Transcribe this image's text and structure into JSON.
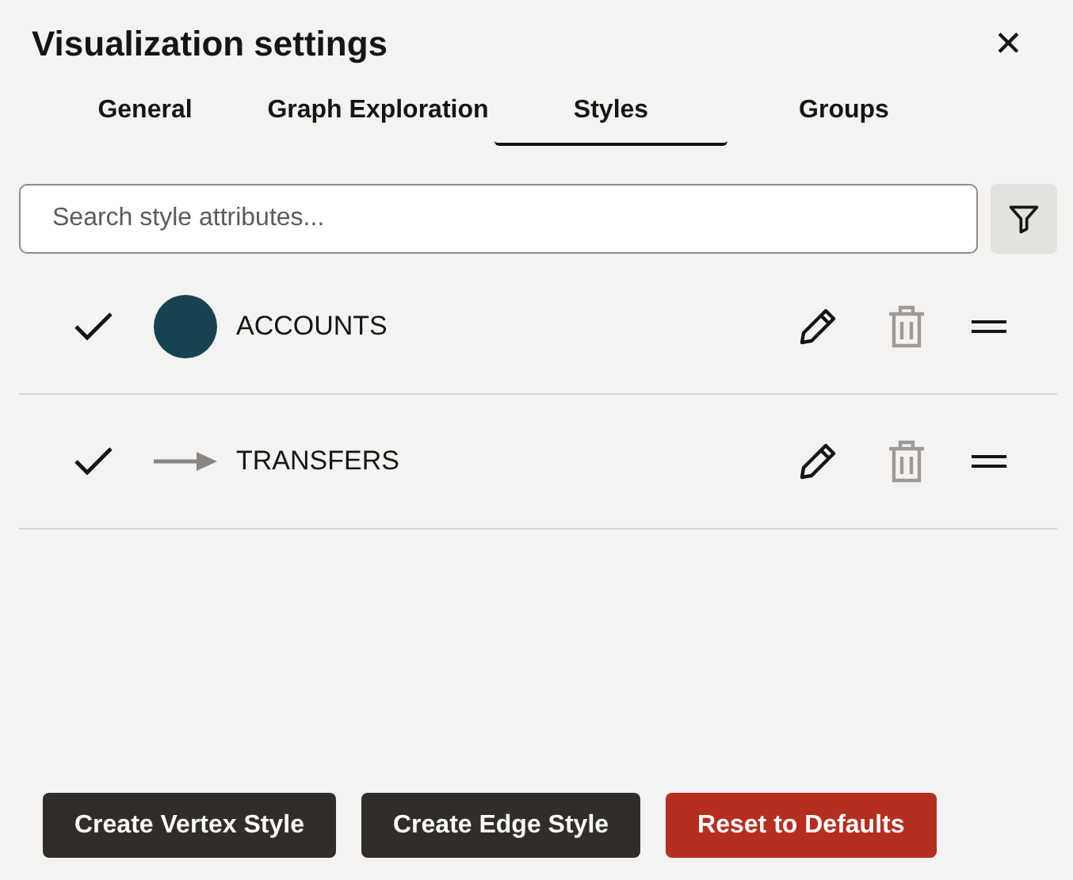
{
  "dialog": {
    "title": "Visualization settings",
    "close": "✕"
  },
  "tabs": [
    {
      "label": "General",
      "selected": false
    },
    {
      "label": "Graph Exploration",
      "selected": false
    },
    {
      "label": "Styles",
      "selected": true
    },
    {
      "label": "Groups",
      "selected": false
    }
  ],
  "search": {
    "placeholder": "Search style attributes..."
  },
  "styles": [
    {
      "kind": "vertex",
      "label": "ACCOUNTS",
      "checked": true,
      "color": "#164352",
      "delete_disabled": true
    },
    {
      "kind": "edge",
      "label": "TRANSFERS",
      "checked": true,
      "color": "#8a8580",
      "delete_disabled": true
    }
  ],
  "buttons": [
    {
      "label": "Create Vertex Style",
      "kind": "dark"
    },
    {
      "label": "Create Edge Style",
      "kind": "dark"
    },
    {
      "label": "Reset to Defaults",
      "kind": "danger"
    }
  ]
}
